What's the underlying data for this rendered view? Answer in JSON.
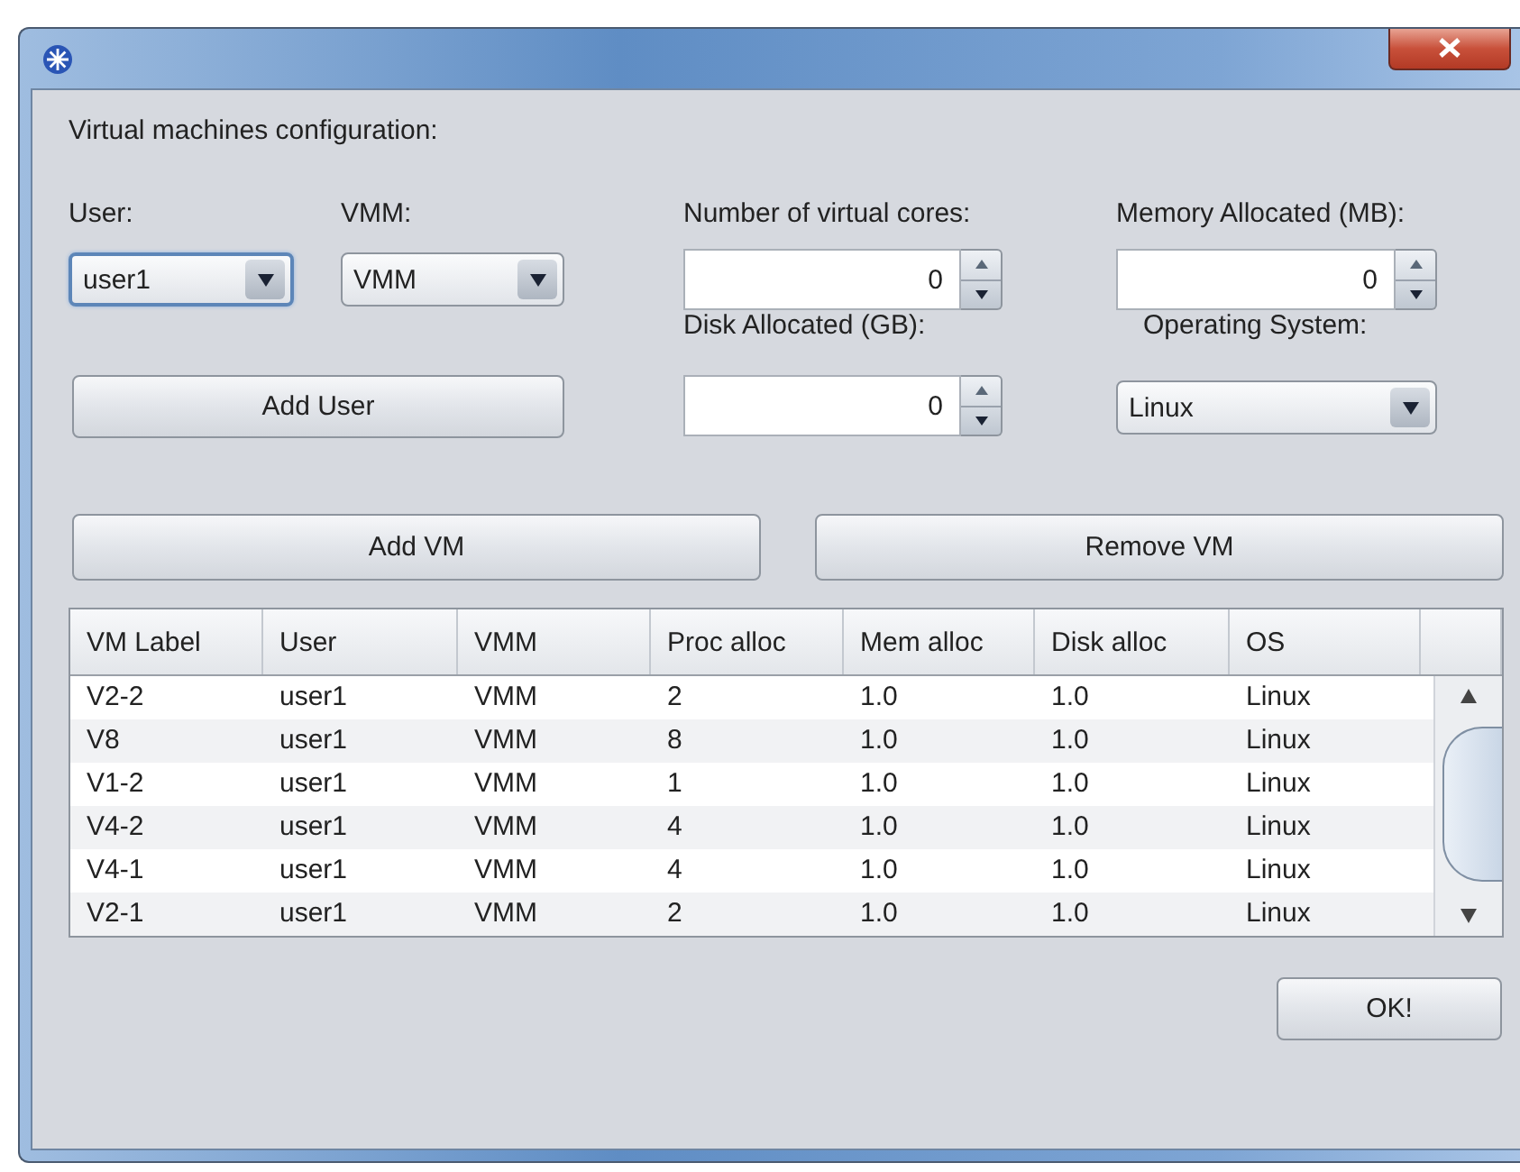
{
  "heading": "Virtual machines configuration:",
  "fields": [
    {
      "kind": "combo",
      "label": "User:",
      "value": "user1",
      "focused": true
    },
    {
      "kind": "combo",
      "label": "VMM:",
      "value": "VMM",
      "focused": false
    },
    {
      "kind": "spinner",
      "label": "Number of virtual cores:",
      "value": "0"
    },
    {
      "kind": "spinner",
      "label": "Memory Allocated (MB):",
      "value": "0"
    },
    {
      "kind": "button",
      "label": "Add User"
    },
    {
      "kind": "spinner",
      "label": "Disk Allocated (GB):",
      "value": "0"
    },
    {
      "kind": "combo",
      "label": "Operating System:",
      "value": "Linux",
      "focused": false
    }
  ],
  "actions": [
    "Add VM",
    "Remove VM"
  ],
  "table": {
    "columns": [
      "VM Label",
      "User",
      "VMM",
      "Proc alloc",
      "Mem alloc",
      "Disk alloc",
      "OS"
    ],
    "rows": [
      [
        "V2-2",
        "user1",
        "VMM",
        "2",
        "1.0",
        "1.0",
        "Linux"
      ],
      [
        "V8",
        "user1",
        "VMM",
        "8",
        "1.0",
        "1.0",
        "Linux"
      ],
      [
        "V1-2",
        "user1",
        "VMM",
        "1",
        "1.0",
        "1.0",
        "Linux"
      ],
      [
        "V4-2",
        "user1",
        "VMM",
        "4",
        "1.0",
        "1.0",
        "Linux"
      ],
      [
        "V4-1",
        "user1",
        "VMM",
        "4",
        "1.0",
        "1.0",
        "Linux"
      ],
      [
        "V2-1",
        "user1",
        "VMM",
        "2",
        "1.0",
        "1.0",
        "Linux"
      ]
    ]
  },
  "ok_button": "OK!"
}
